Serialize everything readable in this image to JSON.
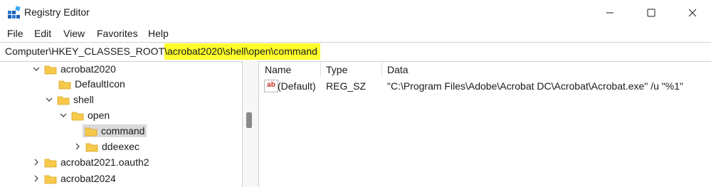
{
  "window": {
    "title": "Registry Editor"
  },
  "menu": [
    "File",
    "Edit",
    "View",
    "Favorites",
    "Help"
  ],
  "address": {
    "prefix": "Computer\\HKEY_CLASSES_ROOT",
    "highlighted": "\\acrobat2020\\shell\\open\\command"
  },
  "tree": {
    "items": [
      {
        "label": "acrobat2020",
        "expanded": true
      },
      {
        "label": "DefaultIcon"
      },
      {
        "label": "shell",
        "expanded": true
      },
      {
        "label": "open",
        "expanded": true
      },
      {
        "label": "command",
        "selected": true
      },
      {
        "label": "ddeexec",
        "expanded": false
      },
      {
        "label": "acrobat2021.oauth2",
        "expanded": false
      },
      {
        "label": "acrobat2024",
        "expanded": false
      }
    ]
  },
  "list": {
    "columns": [
      "Name",
      "Type",
      "Data"
    ],
    "rows": [
      {
        "name": "(Default)",
        "type": "REG_SZ",
        "data": "\"C:\\Program Files\\Adobe\\Acrobat DC\\Acrobat\\Acrobat.exe\" /u \"%1\""
      }
    ]
  },
  "colors": {
    "highlight": "#ffff2b",
    "selection": "#d9d9d9",
    "folder": "#f6c94b"
  }
}
